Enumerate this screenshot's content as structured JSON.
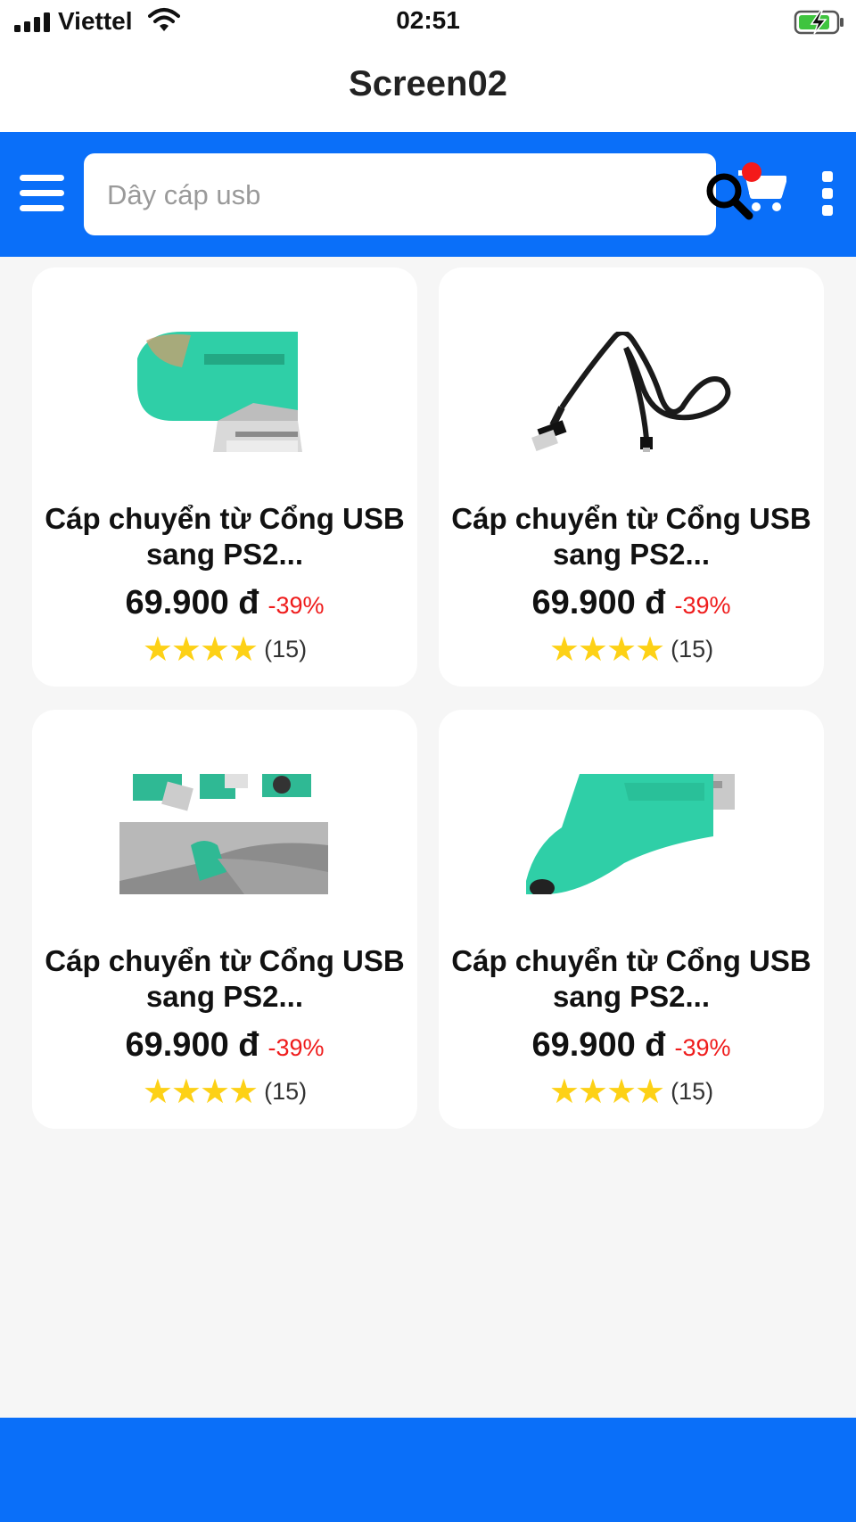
{
  "status_bar": {
    "carrier": "Viettel",
    "time": "02:51",
    "signal_icon": "signal-bars-icon",
    "wifi_icon": "wifi-icon",
    "battery_icon": "battery-charging-icon"
  },
  "title_bar": {
    "title": "Screen02"
  },
  "toolbar": {
    "menu_icon": "hamburger-menu-icon",
    "search_placeholder": "Dây cáp usb",
    "search_value": "",
    "search_icon": "search-icon",
    "cart_icon": "shopping-cart-icon",
    "more_icon": "more-vertical-icon"
  },
  "products": [
    {
      "title": "Cáp chuyển từ Cổng USB sang PS2...",
      "price": "69.900 đ",
      "discount": "-39%",
      "rating": 4,
      "stars": "★★★★",
      "reviews": "(15)",
      "image": "green usb-to-ps2 adapter"
    },
    {
      "title": "Cáp chuyển từ Cổng USB sang PS2...",
      "price": "69.900 đ",
      "discount": "-39%",
      "rating": 4,
      "stars": "★★★★",
      "reviews": "(15)",
      "image": "black usb cable"
    },
    {
      "title": "Cáp chuyển từ Cổng USB sang PS2...",
      "price": "69.900 đ",
      "discount": "-39%",
      "rating": 4,
      "stars": "★★★★",
      "reviews": "(15)",
      "image": "usb ps2 adapters set"
    },
    {
      "title": "Cáp chuyển từ Cổng USB sang PS2...",
      "price": "69.900 đ",
      "discount": "-39%",
      "rating": 4,
      "stars": "★★★★",
      "reviews": "(15)",
      "image": "green ps2 adapter"
    }
  ],
  "colors": {
    "primary": "#0a6ff9",
    "badge": "#f41a1a",
    "discount": "#ef1c1c",
    "star": "#fdd116",
    "background": "#f6f6f6",
    "adapter_green": "#2fcfa7"
  }
}
